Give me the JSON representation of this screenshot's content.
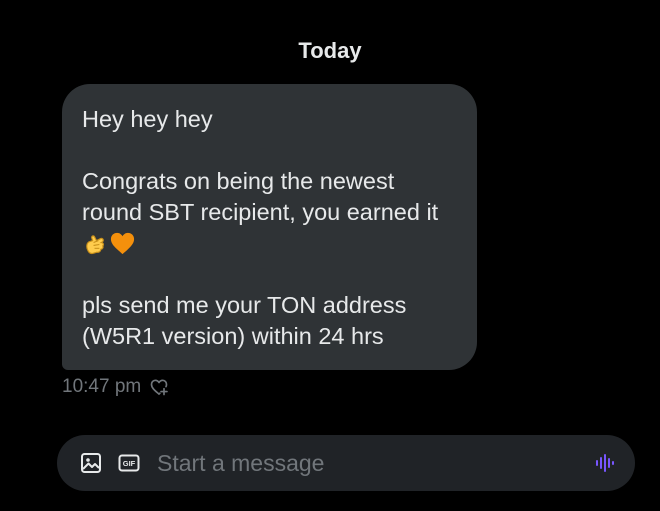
{
  "conversation": {
    "date_separator": "Today"
  },
  "message": {
    "line1": "Hey hey hey",
    "paragraph2_text": "Congrats on being the newest round SBT recipient, you earned it ",
    "emojis": [
      "pinching-hand-emoji",
      "orange-heart-emoji"
    ],
    "paragraph3": "pls send me your TON address (W5R1 version) within 24 hrs",
    "timestamp": "10:47 pm"
  },
  "composer": {
    "placeholder": "Start a message",
    "gif_label": "GIF"
  },
  "icons": {
    "reaction": "heart-plus-icon",
    "media": "image-icon",
    "gif": "gif-icon",
    "voice": "voice-waveform-icon"
  },
  "colors": {
    "background": "#000000",
    "bubble": "#2f3336",
    "composer": "#202327",
    "text": "#e7e9ea",
    "muted": "#71767b",
    "accent_voice": "#7856ff",
    "heart_emoji": "#f4900c",
    "hand_emoji": "#ffcc4d"
  }
}
